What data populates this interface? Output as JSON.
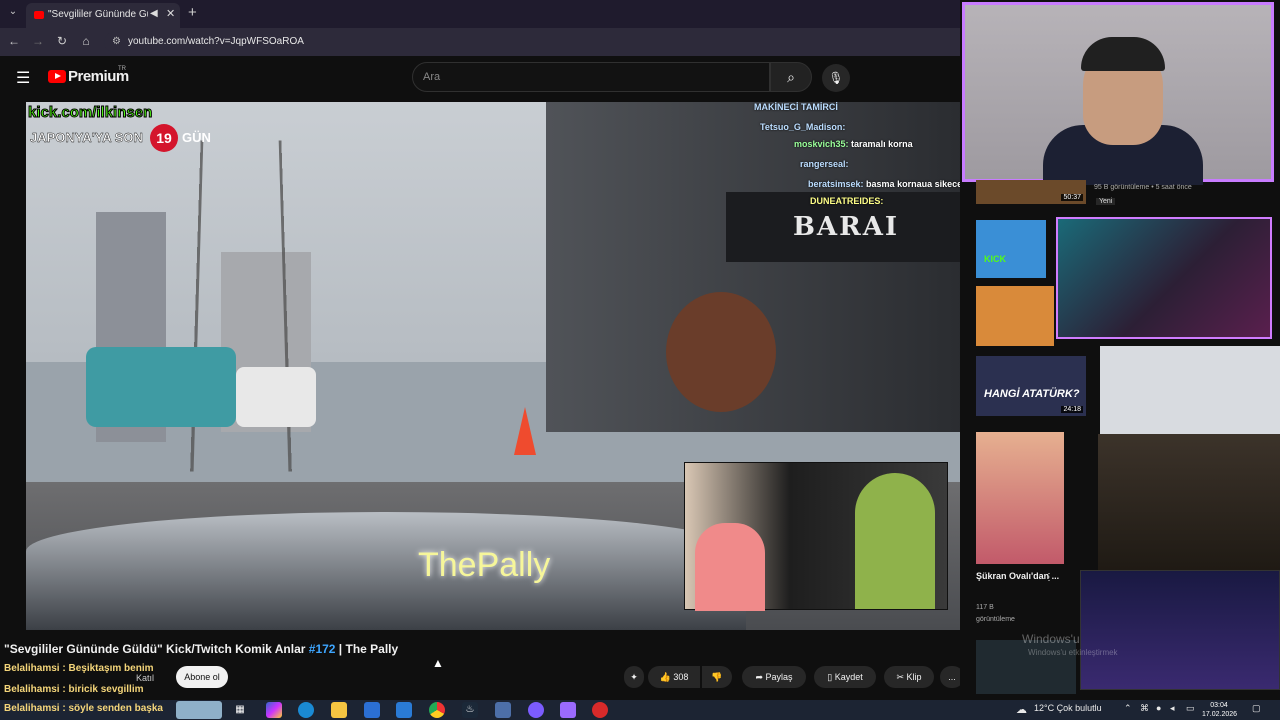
{
  "browser": {
    "tab_title": "\"Sevgililer Gününde Güldü",
    "url": "youtube.com/watch?v=JqpWFSOaROA",
    "new_tab": "+"
  },
  "youtube": {
    "logo_text": "Premium",
    "logo_region": "TR",
    "search_placeholder": "Ara"
  },
  "video_overlay": {
    "kick_url": "kick.com/ilkinsen",
    "countdown_prefix": "JAPONYA'YA SON",
    "countdown_days": "19",
    "countdown_suffix": "GÜN",
    "shop_sign": "BARAI",
    "watermark": "ThePally",
    "chat": [
      {
        "user": "MAKİNECİ TAMİRCİ",
        "text": ""
      },
      {
        "user": "Tetsuo_G_Madison:",
        "text": ""
      },
      {
        "user": "moskvich35:",
        "text": "taramalı korna"
      },
      {
        "user": "rangerseal:",
        "text": ""
      },
      {
        "user": "beratsimsek:",
        "text": "basma kornaua sikecem"
      },
      {
        "user": "DUNEATREIDES:",
        "text": ""
      }
    ]
  },
  "video_info": {
    "title_main": "\"Sevgililer Gününde Güldü\" Kick/Twitch Komik Anlar ",
    "title_number": "#172",
    "title_channel": " | The Pally",
    "overlay_chat_1": "Belalihamsi : Beşiktaşım benim",
    "overlay_chat_2": "Belalihamsi : biricik sevgillim",
    "overlay_chat_3": "Belalihamsi : söyle senden başka",
    "join_label": "Katıl",
    "subscribe_label": "Abone ol",
    "like_count": "308",
    "share_label": "Paylaş",
    "save_label": "Kaydet",
    "clip_label": "Klip",
    "more_label": "..."
  },
  "sidebar": {
    "video1": {
      "duration": "50:37",
      "views_time": "95 B görüntüleme • 5 saat önce",
      "badge": "Yeni"
    },
    "video2": {
      "thumb_text": "KICK"
    },
    "video3": {
      "thumb_text": "HANGİ ATATÜRK?",
      "duration": "24:18"
    },
    "video4": {
      "title": "Şükran Ovalı'dan ...",
      "views": "117 B",
      "views_label": "görüntüleme"
    },
    "windows_watermark": "Windows'u",
    "windows_watermark_sub": "Windows'u etkinleştirmek"
  },
  "taskbar": {
    "weather": "12°C Çok bulutlu",
    "time": "03:04",
    "date": "17.02.2026"
  }
}
